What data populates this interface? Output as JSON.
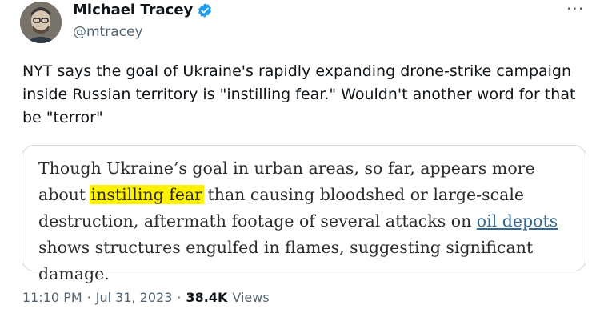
{
  "author": {
    "name": "Michael Tracey",
    "handle": "@mtracey",
    "verified": true,
    "avatar_icon": "avatar-portrait"
  },
  "menu": {
    "more_label": "···"
  },
  "tweet": {
    "text": "NYT says the goal of Ukraine's rapidly expanding drone-strike campaign inside Russian territory is \"instilling fear.\" Wouldn't another word for that be \"terror\""
  },
  "quote": {
    "part1": "Though Ukraine’s goal in urban areas, so far, appears more about ",
    "highlight": "instilling fear",
    "part2": " than causing bloodshed or large-scale destruction, aftermath footage of several attacks on ",
    "link": "oil depots",
    "part3": " shows structures engulfed in flames, suggesting significant damage."
  },
  "meta": {
    "time": "11:10 PM",
    "sep1": "·",
    "date": "Jul 31, 2023",
    "sep2": "·",
    "views_count": "38.4K",
    "views_label": "Views"
  },
  "colors": {
    "verified": "#1d9bf0",
    "highlight": "#fff200",
    "link": "#326891",
    "muted": "#536471"
  }
}
